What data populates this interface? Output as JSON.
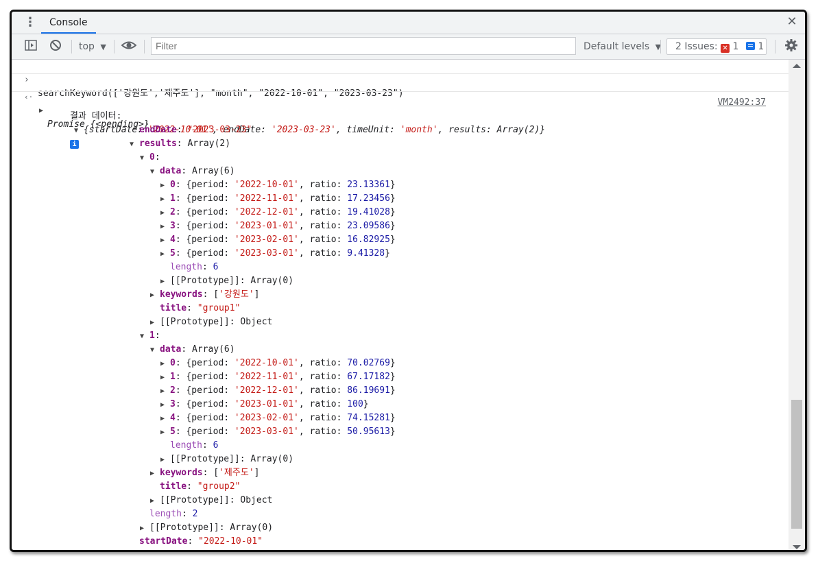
{
  "tabbar": {
    "tab_label": "Console",
    "close_glyph": "✕"
  },
  "toolbar": {
    "context": "top",
    "filter_placeholder": "Filter",
    "levels": "Default levels",
    "issues_label": "2 Issues:",
    "errors_count": "1",
    "messages_count": "1"
  },
  "console": {
    "command": "searchKeyword(['강원도','제주도'], \"month\", \"2022-10-01\", \"2023-03-23\")",
    "promise": "Promise {<pending>}",
    "log_label": "결과 데이터:",
    "log_summary": "{startDate: '2022-10-01', endDate: '2023-03-23', timeUnit: 'month', results: Array(2)}",
    "source_link": "VM2492:37",
    "lines": [
      {
        "depth": 0,
        "tri": "",
        "key": "endDate",
        "value": "\"2023-03-23\"",
        "kind": "str"
      },
      {
        "depth": 0,
        "tri": "open",
        "key": "results",
        "value": "Array(2)",
        "kind": "plain"
      },
      {
        "depth": 1,
        "tri": "open",
        "key": "0",
        "value": "",
        "kind": "plain"
      },
      {
        "depth": 2,
        "tri": "open",
        "key": "data",
        "value": "Array(6)",
        "kind": "plain"
      },
      {
        "depth": 3,
        "tri": "closed",
        "key": "0",
        "period": "'2022-10-01'",
        "ratio": "23.13361",
        "kind": "entry"
      },
      {
        "depth": 3,
        "tri": "closed",
        "key": "1",
        "period": "'2022-11-01'",
        "ratio": "17.23456",
        "kind": "entry"
      },
      {
        "depth": 3,
        "tri": "closed",
        "key": "2",
        "period": "'2022-12-01'",
        "ratio": "19.41028",
        "kind": "entry"
      },
      {
        "depth": 3,
        "tri": "closed",
        "key": "3",
        "period": "'2023-01-01'",
        "ratio": "23.09586",
        "kind": "entry"
      },
      {
        "depth": 3,
        "tri": "closed",
        "key": "4",
        "period": "'2023-02-01'",
        "ratio": "16.82925",
        "kind": "entry"
      },
      {
        "depth": 3,
        "tri": "closed",
        "key": "5",
        "period": "'2023-03-01'",
        "ratio": "9.41328",
        "kind": "entry"
      },
      {
        "depth": 3,
        "tri": "",
        "key": "length",
        "value": "6",
        "kind": "len"
      },
      {
        "depth": 3,
        "tri": "closed",
        "key": "[[Prototype]]",
        "value": "Array(0)",
        "kind": "proto"
      },
      {
        "depth": 2,
        "tri": "closed",
        "key": "keywords",
        "value": "['강원도']",
        "kind": "kw"
      },
      {
        "depth": 2,
        "tri": "",
        "key": "title",
        "value": "\"group1\"",
        "kind": "str"
      },
      {
        "depth": 2,
        "tri": "closed",
        "key": "[[Prototype]]",
        "value": "Object",
        "kind": "proto"
      },
      {
        "depth": 1,
        "tri": "open",
        "key": "1",
        "value": "",
        "kind": "plain"
      },
      {
        "depth": 2,
        "tri": "open",
        "key": "data",
        "value": "Array(6)",
        "kind": "plain"
      },
      {
        "depth": 3,
        "tri": "closed",
        "key": "0",
        "period": "'2022-10-01'",
        "ratio": "70.02769",
        "kind": "entry"
      },
      {
        "depth": 3,
        "tri": "closed",
        "key": "1",
        "period": "'2022-11-01'",
        "ratio": "67.17182",
        "kind": "entry"
      },
      {
        "depth": 3,
        "tri": "closed",
        "key": "2",
        "period": "'2022-12-01'",
        "ratio": "86.19691",
        "kind": "entry"
      },
      {
        "depth": 3,
        "tri": "closed",
        "key": "3",
        "period": "'2023-01-01'",
        "ratio": "100",
        "kind": "entry"
      },
      {
        "depth": 3,
        "tri": "closed",
        "key": "4",
        "period": "'2023-02-01'",
        "ratio": "74.15281",
        "kind": "entry"
      },
      {
        "depth": 3,
        "tri": "closed",
        "key": "5",
        "period": "'2023-03-01'",
        "ratio": "50.95613",
        "kind": "entry"
      },
      {
        "depth": 3,
        "tri": "",
        "key": "length",
        "value": "6",
        "kind": "len"
      },
      {
        "depth": 3,
        "tri": "closed",
        "key": "[[Prototype]]",
        "value": "Array(0)",
        "kind": "proto"
      },
      {
        "depth": 2,
        "tri": "closed",
        "key": "keywords",
        "value": "['제주도']",
        "kind": "kw"
      },
      {
        "depth": 2,
        "tri": "",
        "key": "title",
        "value": "\"group2\"",
        "kind": "str"
      },
      {
        "depth": 2,
        "tri": "closed",
        "key": "[[Prototype]]",
        "value": "Object",
        "kind": "proto"
      },
      {
        "depth": 1,
        "tri": "",
        "key": "length",
        "value": "2",
        "kind": "len"
      },
      {
        "depth": 1,
        "tri": "closed",
        "key": "[[Prototype]]",
        "value": "Array(0)",
        "kind": "proto"
      },
      {
        "depth": 0,
        "tri": "",
        "key": "startDate",
        "value": "\"2022-10-01\"",
        "kind": "str"
      },
      {
        "depth": 0,
        "tri": "",
        "key": "timeUnit",
        "value": "\"month\"",
        "kind": "str"
      }
    ]
  },
  "colors": {
    "accent": "#1a73e8",
    "error": "#d93025",
    "key": "#881280",
    "string": "#c41a16",
    "number": "#1a1aa6"
  },
  "icons": [
    "more-vert-icon",
    "close-icon",
    "sidebar-icon",
    "clear-icon",
    "eye-icon",
    "chevron-down-icon",
    "gear-icon",
    "info-icon",
    "expand-triangle-icon"
  ]
}
